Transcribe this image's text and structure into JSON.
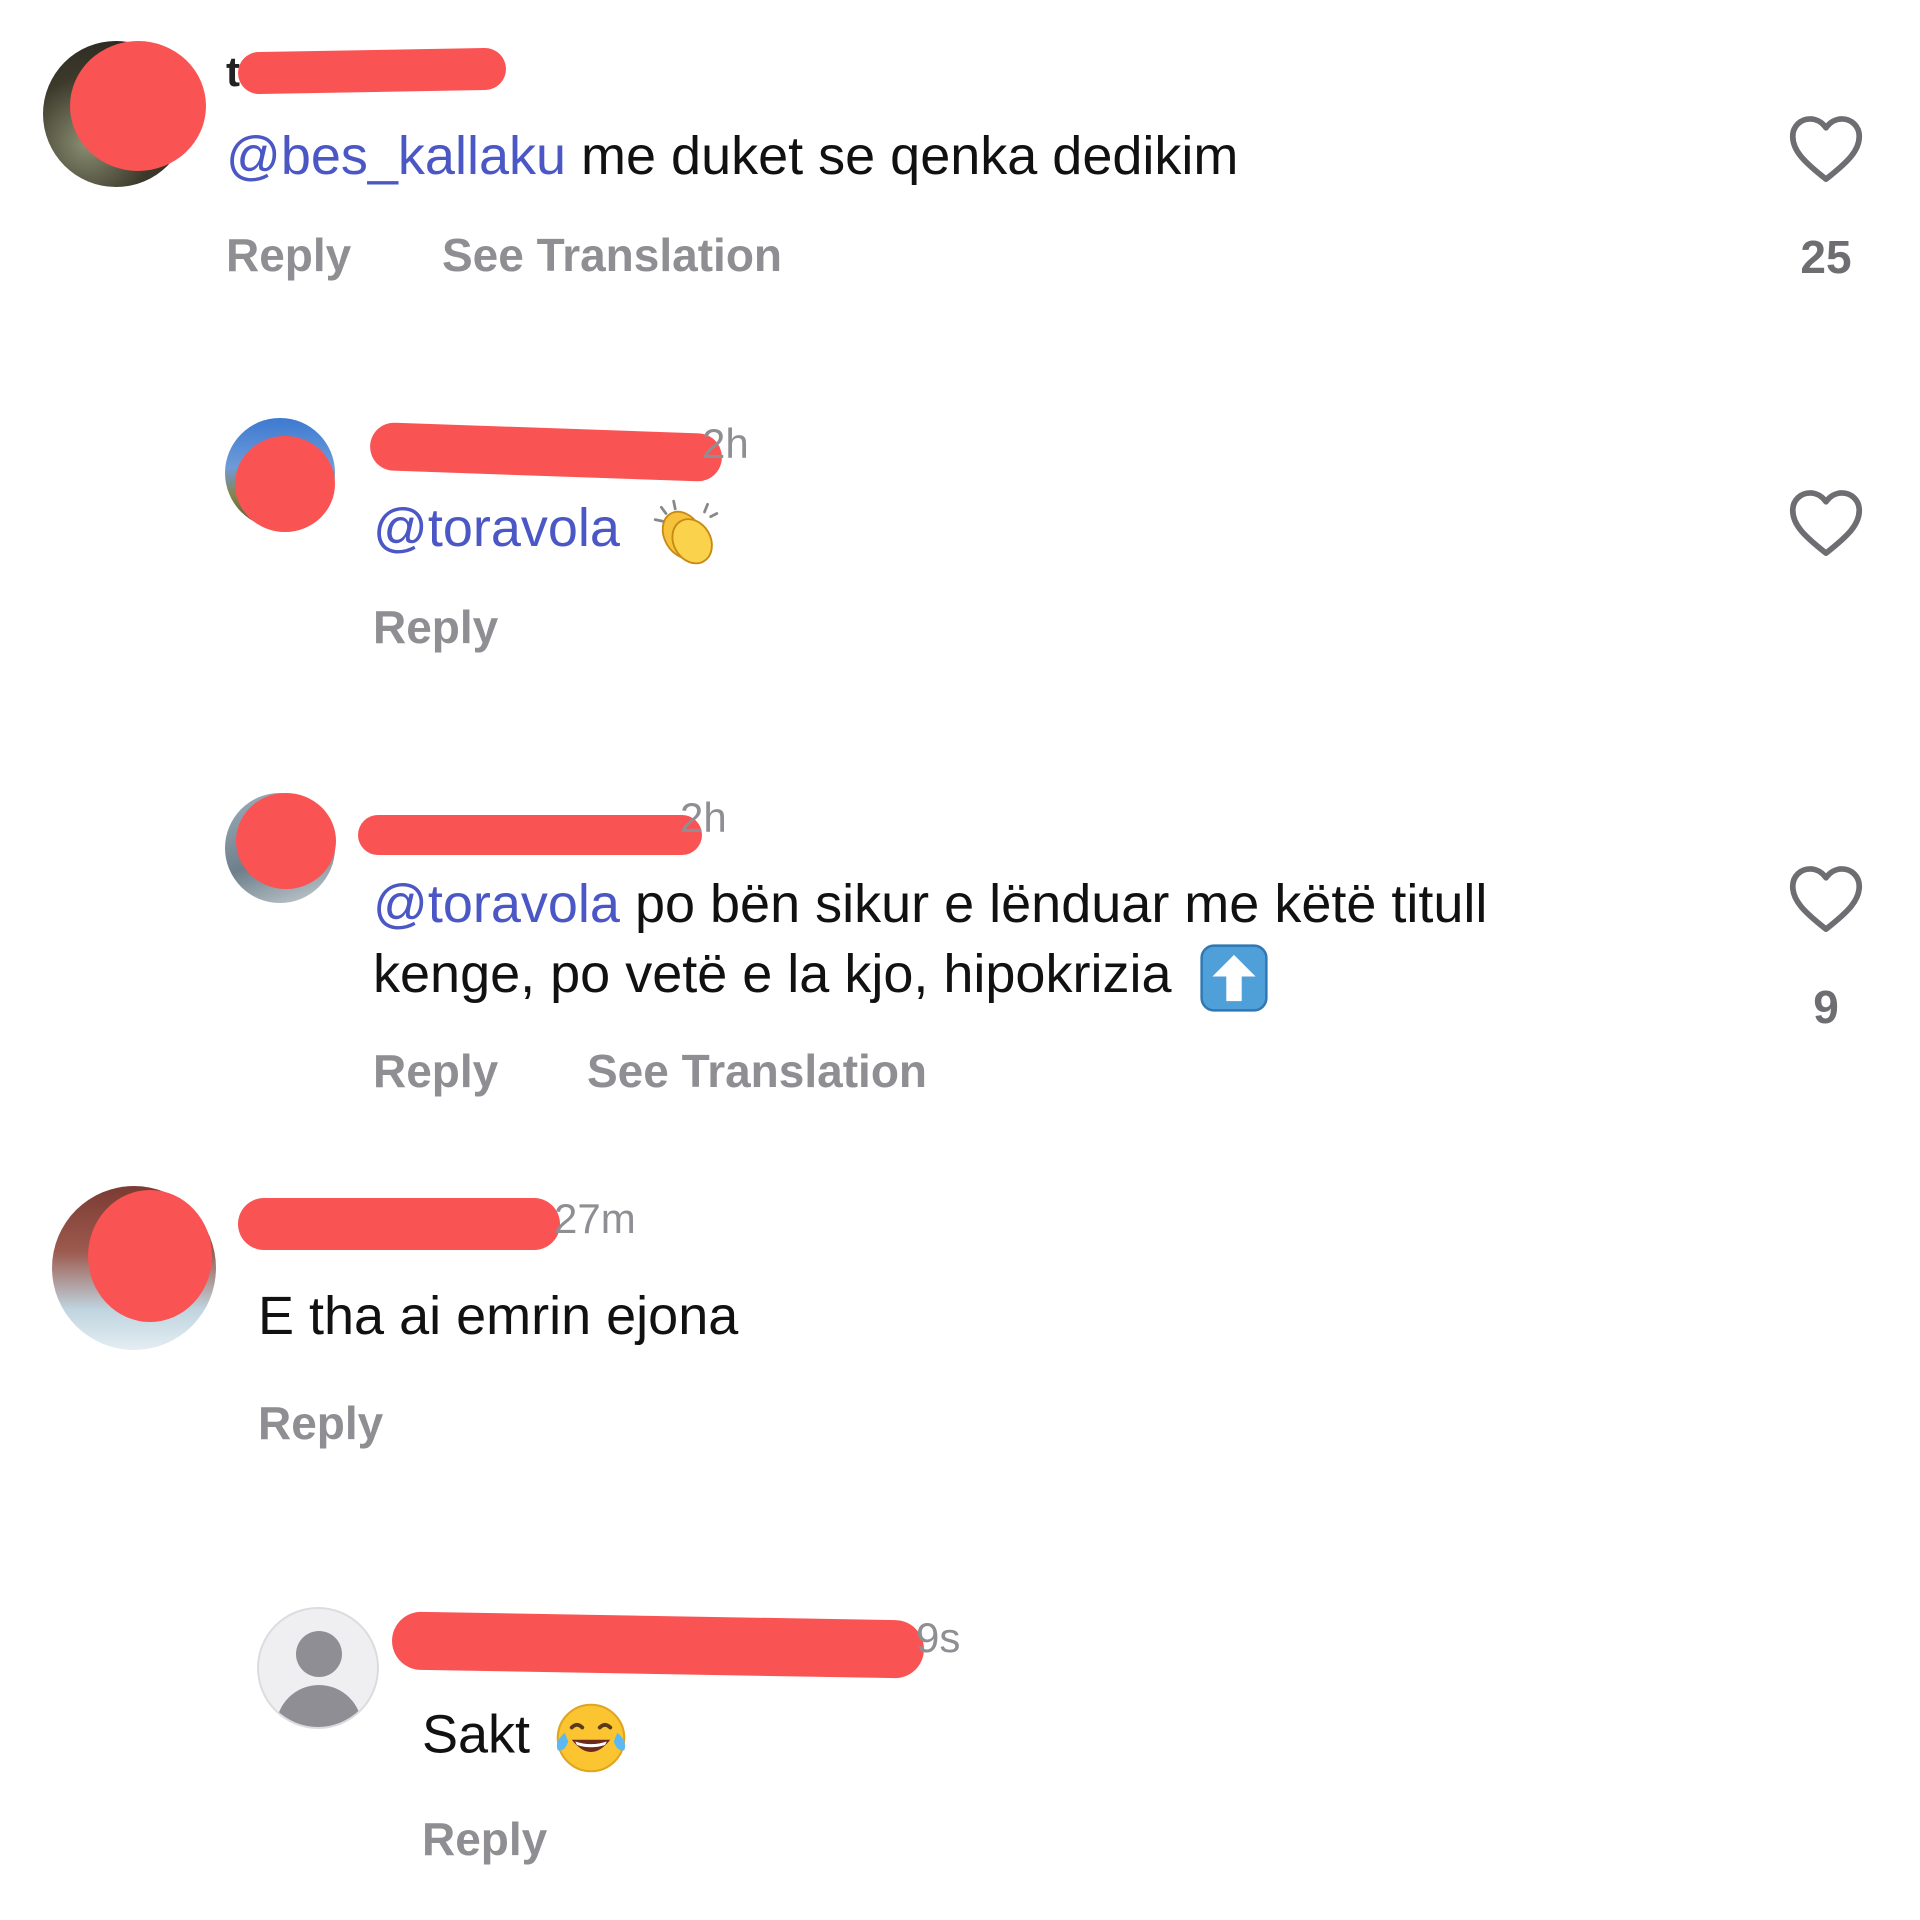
{
  "comments": [
    {
      "username": "t",
      "mention": "@bes_kallaku",
      "text": " me duket se qenka dedikim",
      "actions": [
        "Reply",
        "See Translation"
      ],
      "likes": "25"
    },
    {
      "username": "",
      "time": "2h",
      "mention": "@toravola",
      "emoji": "clapping-hands",
      "actions": [
        "Reply"
      ]
    },
    {
      "username": "",
      "time": "2h",
      "mention": "@toravola",
      "text_line1": " po bën sikur e lënduar me këtë titull",
      "text_line2": "kenge, po vetë e la kjo, hipokrizia",
      "emoji": "up-arrow",
      "actions": [
        "Reply",
        "See Translation"
      ],
      "likes": "9"
    },
    {
      "username": "",
      "time": "27m",
      "text": "E tha ai emrin ejona",
      "actions": [
        "Reply"
      ]
    },
    {
      "username": "",
      "time": "9s",
      "text": "Sakt",
      "emoji": "face-with-tears-of-joy",
      "actions": [
        "Reply"
      ]
    }
  ],
  "colors": {
    "mention": "#4b57c4",
    "redaction": "#fa5353",
    "secondary_text": "#8e8e93"
  }
}
